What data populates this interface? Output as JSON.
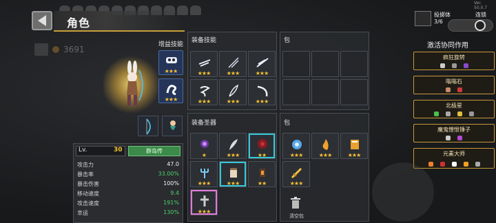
{
  "header": {
    "title": "角色"
  },
  "currency": {
    "gold": "3691"
  },
  "gain_skills": {
    "label": "增益技能"
  },
  "equip_skills": {
    "label": "装备技能"
  },
  "bag_top": {
    "label": "包"
  },
  "equip_relics": {
    "label": "装备圣器"
  },
  "bag_bottom": {
    "label": "包"
  },
  "stats": {
    "level_label": "Lv.",
    "level": "30",
    "detail_button": "群岛传",
    "rows": [
      {
        "key": "攻击力",
        "value": "47.0",
        "color": "normal"
      },
      {
        "key": "暴击率",
        "value": "33.00%",
        "color": "green"
      },
      {
        "key": "暴击伤害",
        "value": "100%",
        "color": "normal"
      },
      {
        "key": "移动速度",
        "value": "9.4",
        "color": "green"
      },
      {
        "key": "攻击速度",
        "value": "191%",
        "color": "green"
      },
      {
        "key": "幸运",
        "value": "130%",
        "color": "green"
      }
    ]
  },
  "trash": {
    "label": "清空包"
  },
  "topbar": {
    "throw_label": "投掷体",
    "throw_count": "3/6",
    "auto_label": "连锁",
    "version": "Ver. 50.0.7"
  },
  "synergy": {
    "title": "激活协同作用",
    "cards": [
      {
        "name": "疯狂旋转"
      },
      {
        "name": "嗡嗡石"
      },
      {
        "name": "北极星"
      },
      {
        "name": "魔鬼憎恨锤子"
      },
      {
        "name": "元素大师"
      }
    ]
  },
  "colors": {
    "accent_gold": "#c99a36",
    "star": "#f6c232",
    "stat_green": "#4fd06a",
    "button_green": "#3c8a4a",
    "cyan_glow": "#35c8d8",
    "pink_glow": "#e47ad8"
  }
}
